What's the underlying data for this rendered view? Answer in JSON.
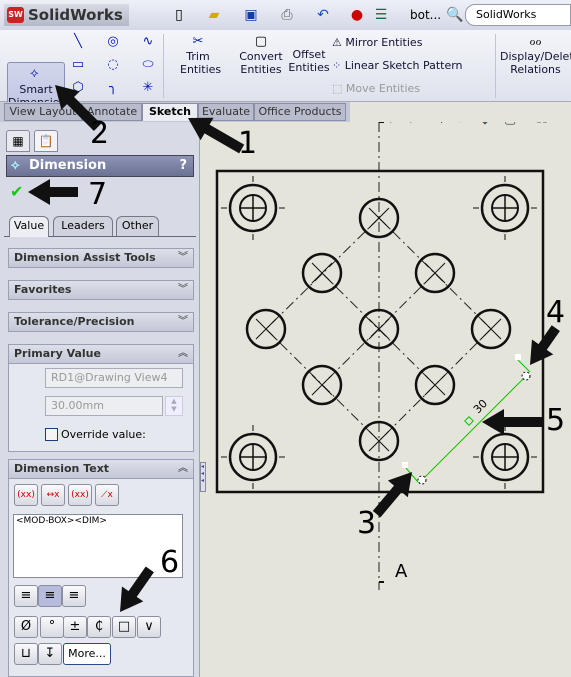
{
  "titlebar": {
    "app_name": "SolidWorks",
    "logo_text": "SW",
    "document": "bot...",
    "search_placeholder": "SolidWorks Search"
  },
  "ribbon": {
    "smart_dimension": "Smart\nDimension",
    "trim": "Trim Entities",
    "convert": "Convert Entities",
    "offset": "Offset Entities",
    "mirror": "Mirror Entities",
    "linear_pattern": "Linear Sketch Pattern",
    "move": "Move Entities",
    "display_relations": "Display/Delete Relations"
  },
  "tabs": [
    "View Layout",
    "Annotate",
    "Sketch",
    "Evaluate",
    "Office Products"
  ],
  "active_tab": "Sketch",
  "panel": {
    "title": "Dimension",
    "help": "?",
    "subtabs": [
      "Value",
      "Leaders",
      "Other"
    ],
    "groups": {
      "assist": "Dimension Assist Tools",
      "favorites": "Favorites",
      "tolerance": "Tolerance/Precision",
      "primary": "Primary Value",
      "dimtext": "Dimension Text"
    },
    "primary_name": "RD1@Drawing View4",
    "primary_value": "30.00mm",
    "override_label": "Override value:",
    "override_checked": false,
    "dim_text": "<MOD-BOX><DIM>",
    "symbols": [
      "Ø",
      "°",
      "±",
      "₵",
      "□",
      "∨"
    ],
    "more": "More..."
  },
  "drawing": {
    "section_label": "A",
    "dimension_value": "30",
    "dimension_color": "#00cc00"
  },
  "callouts": [
    "1",
    "2",
    "3",
    "4",
    "5",
    "6",
    "7"
  ]
}
